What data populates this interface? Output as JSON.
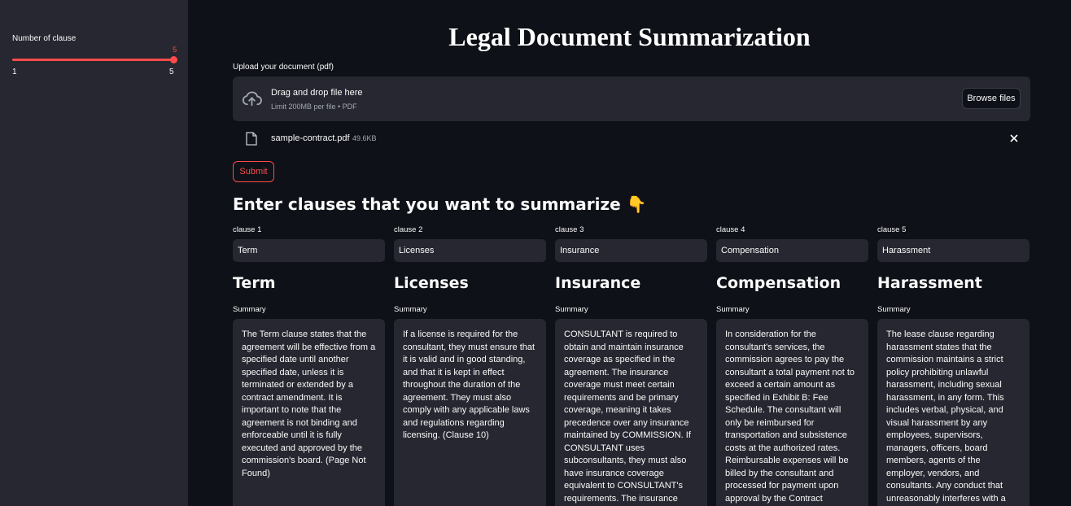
{
  "sidebar": {
    "slider_label": "Number of clause",
    "slider_value": "5",
    "slider_min": "1",
    "slider_max": "5"
  },
  "title": "Legal Document Summarization",
  "upload": {
    "label": "Upload your document (pdf)",
    "drop_text": "Drag and drop file here",
    "limit_text": "Limit 200MB per file • PDF",
    "browse_label": "Browse files",
    "file_name": "sample-contract.pdf",
    "file_size": "49.6KB"
  },
  "submit_label": "Submit",
  "section_heading": "Enter clauses that you want to summarize 👇",
  "summary_label": "Summary",
  "clauses": [
    {
      "label": "clause 1",
      "value": "Term",
      "heading": "Term",
      "summary": "The Term clause states that the agreement will be effective from a specified date until another specified date, unless it is terminated or extended by a contract amendment. It is important to note that the agreement is not binding and enforceable until it is fully executed and approved by the commission's board. (Page Not Found)"
    },
    {
      "label": "clause 2",
      "value": "Licenses",
      "heading": "Licenses",
      "summary": "If a license is required for the consultant, they must ensure that it is valid and in good standing, and that it is kept in effect throughout the duration of the agreement. They must also comply with any applicable laws and regulations regarding licensing. (Clause 10)"
    },
    {
      "label": "clause 3",
      "value": "Insurance",
      "heading": "Insurance",
      "summary": "CONSULTANT is required to obtain and maintain insurance coverage as specified in the agreement. The insurance coverage must meet certain requirements and be primary coverage, meaning it takes precedence over any insurance maintained by COMMISSION. If CONSULTANT uses subconsultants, they must also have insurance coverage equivalent to CONSULTANT's requirements. The insurance policies must include an"
    },
    {
      "label": "clause 4",
      "value": "Compensation",
      "heading": "Compensation",
      "summary": "In consideration for the consultant's services, the commission agrees to pay the consultant a total payment not to exceed a certain amount as specified in Exhibit B: Fee Schedule. The consultant will only be reimbursed for transportation and subsistence costs at the authorized rates. Reimbursable expenses will be billed by the consultant and processed for payment upon approval by the Contract Manager. Progress"
    },
    {
      "label": "clause 5",
      "value": "Harassment",
      "heading": "Harassment",
      "summary": "The lease clause regarding harassment states that the commission maintains a strict policy prohibiting unlawful harassment, including sexual harassment, in any form. This includes verbal, physical, and visual harassment by any employees, supervisors, managers, officers, board members, agents of the employer, vendors, and consultants. Any conduct that unreasonably interferes with a commission"
    }
  ],
  "colors": {
    "accent": "#ff4b4b",
    "background": "#0e1117",
    "panel": "#262730"
  }
}
